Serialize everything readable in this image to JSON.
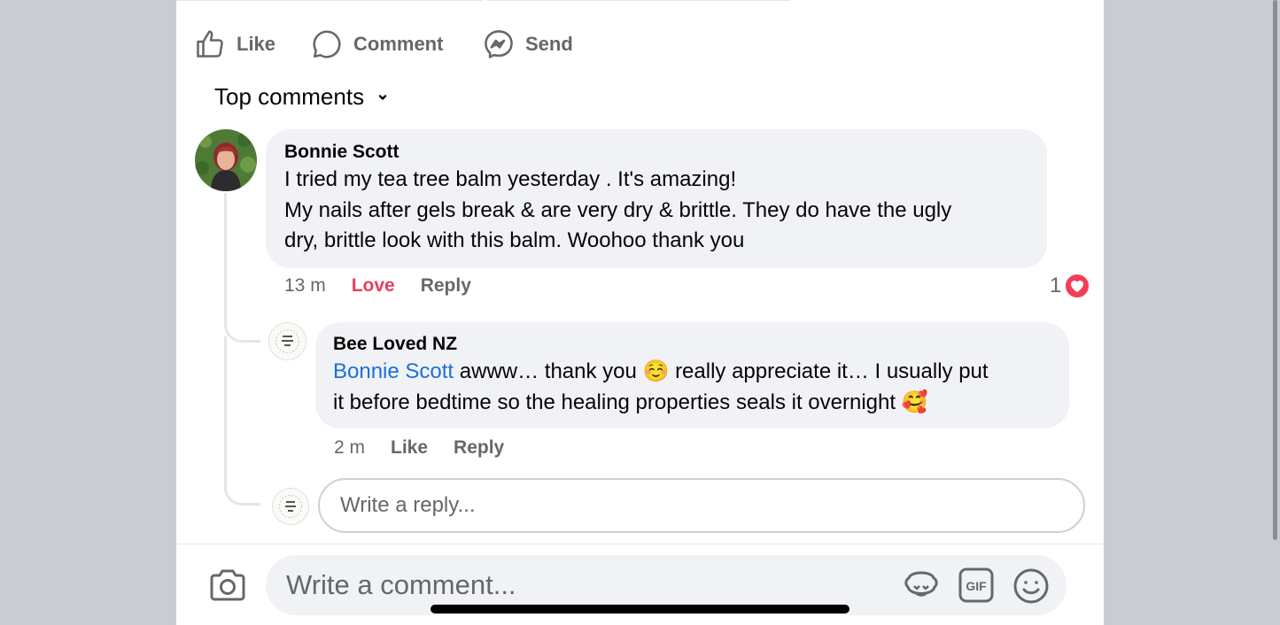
{
  "actions": {
    "like_label": "Like",
    "comment_label": "Comment",
    "send_label": "Send"
  },
  "sort": {
    "label": "Top comments"
  },
  "comments": [
    {
      "author": "Bonnie Scott",
      "lines": [
        "I tried my tea tree balm yesterday . It's amazing!",
        "My nails after gels break & are very dry & brittle. They do have the ugly",
        "dry, brittle look with this balm. Woohoo thank you"
      ],
      "time": "13 m",
      "love_label": "Love",
      "reply_label": "Reply",
      "reaction_count": "1",
      "reply": {
        "author": "Bee Loved NZ",
        "mention": "Bonnie Scott",
        "line1_rest": " awww… thank you ☺️ really appreciate it… I usually put",
        "line2": "it before bedtime so the healing properties seals it overnight 🥰",
        "time": "2 m",
        "like_label": "Like",
        "reply_label": "Reply"
      }
    }
  ],
  "reply_box": {
    "placeholder": "Write a reply..."
  },
  "comment_box": {
    "placeholder": "Write a comment...",
    "gif_label": "GIF"
  },
  "colors": {
    "accent_love": "#e4405f",
    "mention": "#1d6fd6",
    "bubble": "#f0f2f5",
    "secondary_text": "#65676b",
    "page_background": "#c9ccd1"
  }
}
